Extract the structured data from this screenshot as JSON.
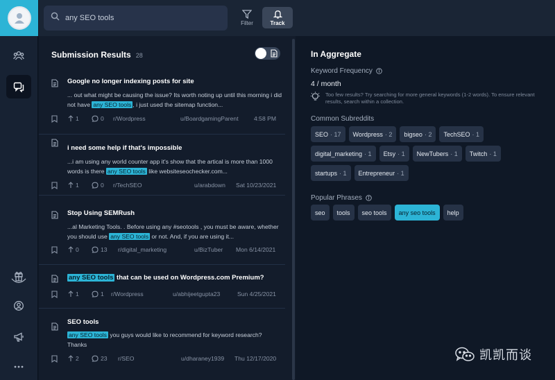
{
  "search": {
    "value": "any SEO tools",
    "placeholder": "Search"
  },
  "toolbar": {
    "filter_label": "Filter",
    "track_label": "Track"
  },
  "results": {
    "title": "Submission Results",
    "count": "28",
    "posts": [
      {
        "title": "Google no longer indexing posts for site",
        "body_pre": "... out what might be causing the issue? Its worth noting up until this morning i did not have ",
        "highlight": "any SEO tools",
        "body_post": ", i just used the sitemap function...",
        "upvotes": "1",
        "comments": "0",
        "subreddit": "r/Wordpress",
        "author": "u/BoardgamingParent",
        "time": "4:58 PM"
      },
      {
        "title": "i need some help if that's impossible",
        "body_pre": "...i am using any world counter app it's show that the artical is more than 1000 words is there ",
        "highlight": "any SEO tools",
        "body_post": " like websiteseochecker.com...",
        "upvotes": "1",
        "comments": "0",
        "subreddit": "r/TechSEO",
        "author": "u/arabdown",
        "time": "Sat 10/23/2021"
      },
      {
        "title": "Stop Using SEMRush",
        "body_pre": "...al Marketing Tools. . Before using any #seotools , you must be aware, whether you should use ",
        "highlight": "any SEO tools",
        "body_post": " or not. And, if you are using it...",
        "upvotes": "0",
        "comments": "13",
        "subreddit": "r/digital_marketing",
        "author": "u/BizTuber",
        "time": "Mon 6/14/2021"
      },
      {
        "title_highlight": "any SEO tools",
        "title_post": " that can be used on Wordpress.com Premium?",
        "upvotes": "1",
        "comments": "1",
        "subreddit": "r/Wordpress",
        "author": "u/abhijeetgupta23",
        "time": "Sun 4/25/2021"
      },
      {
        "title": "SEO tools",
        "body_pre": "",
        "highlight": "any SEO tools",
        "body_post": " you guys would like to recommend for keyword research? Thanks",
        "upvotes": "2",
        "comments": "23",
        "subreddit": "r/SEO",
        "author": "u/dharaney1939",
        "time": "Thu 12/17/2020"
      }
    ]
  },
  "aggregate": {
    "title": "In Aggregate",
    "keyword_frequency_label": "Keyword Frequency",
    "frequency_value": "4 / month",
    "tip": "Too few results? Try searching for more general keywords (1-2 words). To ensure relevant results, search within a collection.",
    "subreddits_label": "Common Subreddits",
    "subreddits": [
      {
        "name": "SEO",
        "count": "17"
      },
      {
        "name": "Wordpress",
        "count": "2"
      },
      {
        "name": "bigseo",
        "count": "2"
      },
      {
        "name": "TechSEO",
        "count": "1"
      },
      {
        "name": "digital_marketing",
        "count": "1"
      },
      {
        "name": "Etsy",
        "count": "1"
      },
      {
        "name": "NewTubers",
        "count": "1"
      },
      {
        "name": "Twitch",
        "count": "1"
      },
      {
        "name": "startups",
        "count": "1"
      },
      {
        "name": "Entrepreneur",
        "count": "1"
      }
    ],
    "phrases_label": "Popular Phrases",
    "phrases": [
      "seo",
      "tools",
      "seo tools",
      "any seo tools",
      "help"
    ],
    "selected_phrase": "any seo tools"
  },
  "watermark": "凯凯而谈",
  "icons": [
    "search-icon",
    "filter-icon",
    "bell-icon",
    "people-icon",
    "chat-icon",
    "gift-icon",
    "user-icon",
    "megaphone-icon",
    "more-icon",
    "document-icon",
    "bookmark-icon",
    "upvote-icon",
    "comment-icon",
    "info-icon",
    "lightbulb-icon"
  ],
  "colors": {
    "accent": "#2cb4d6",
    "background": "#0f1826",
    "panel": "#131c2b",
    "chip": "#263246"
  }
}
